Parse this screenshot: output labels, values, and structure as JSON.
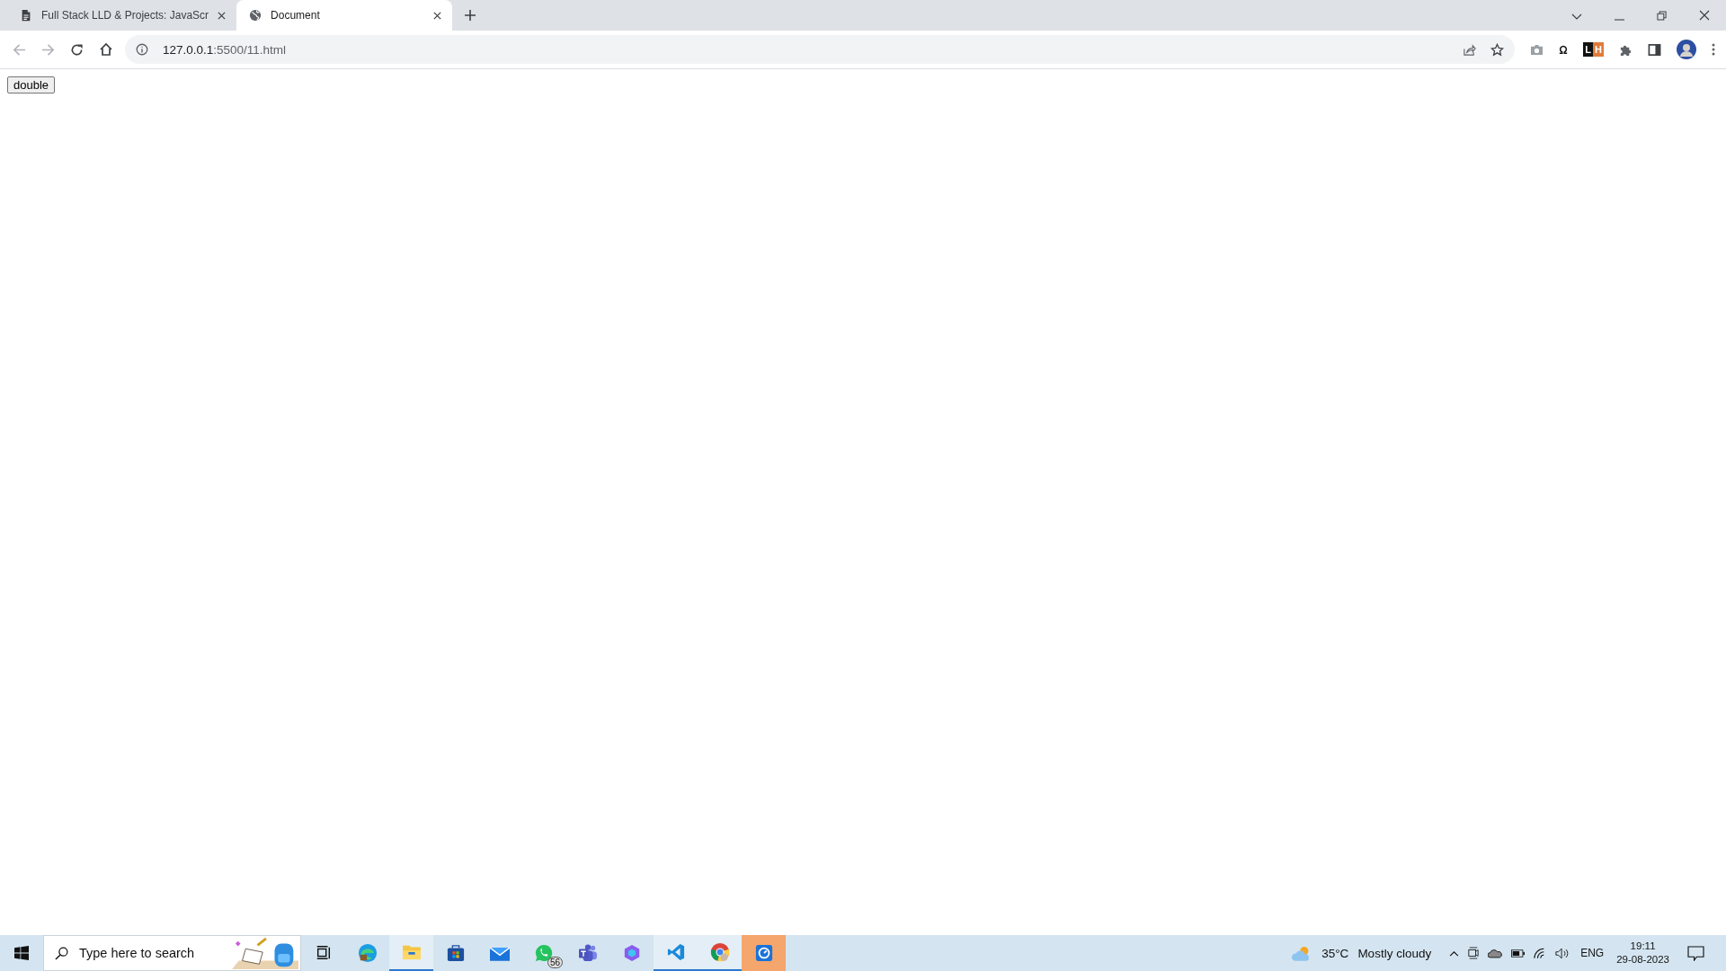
{
  "browser": {
    "tabs": [
      {
        "kind": "document",
        "title": "Full Stack LLD & Projects: JavaScr",
        "selected": false
      },
      {
        "kind": "globe",
        "title": "Document",
        "selected": true
      }
    ],
    "address": {
      "host": "127.0.0.1",
      "path": ":5500/11.html"
    },
    "extension_letters": [
      "L",
      "H"
    ]
  },
  "page": {
    "button": "double"
  },
  "taskbar": {
    "search_placeholder": "Type here to search",
    "apps": [
      {
        "kind": "taskview",
        "running": false,
        "selected": false
      },
      {
        "kind": "edge",
        "running": false,
        "selected": false
      },
      {
        "kind": "explorer",
        "running": true,
        "selected": false
      },
      {
        "kind": "store",
        "running": false,
        "selected": false
      },
      {
        "kind": "mail",
        "running": false,
        "selected": false
      },
      {
        "kind": "whatsapp",
        "running": false,
        "selected": false,
        "badge": "56"
      },
      {
        "kind": "teams",
        "running": false,
        "selected": false
      },
      {
        "kind": "copilot",
        "running": false,
        "selected": false
      },
      {
        "kind": "vscode",
        "running": true,
        "selected": false
      },
      {
        "kind": "chrome",
        "running": true,
        "selected": false
      },
      {
        "kind": "gauge",
        "running": false,
        "selected": true
      }
    ],
    "weather": {
      "temperature": "35°C",
      "condition": "Mostly cloudy"
    },
    "language": "ENG",
    "time": "19:11",
    "date": "29-08-2023"
  }
}
